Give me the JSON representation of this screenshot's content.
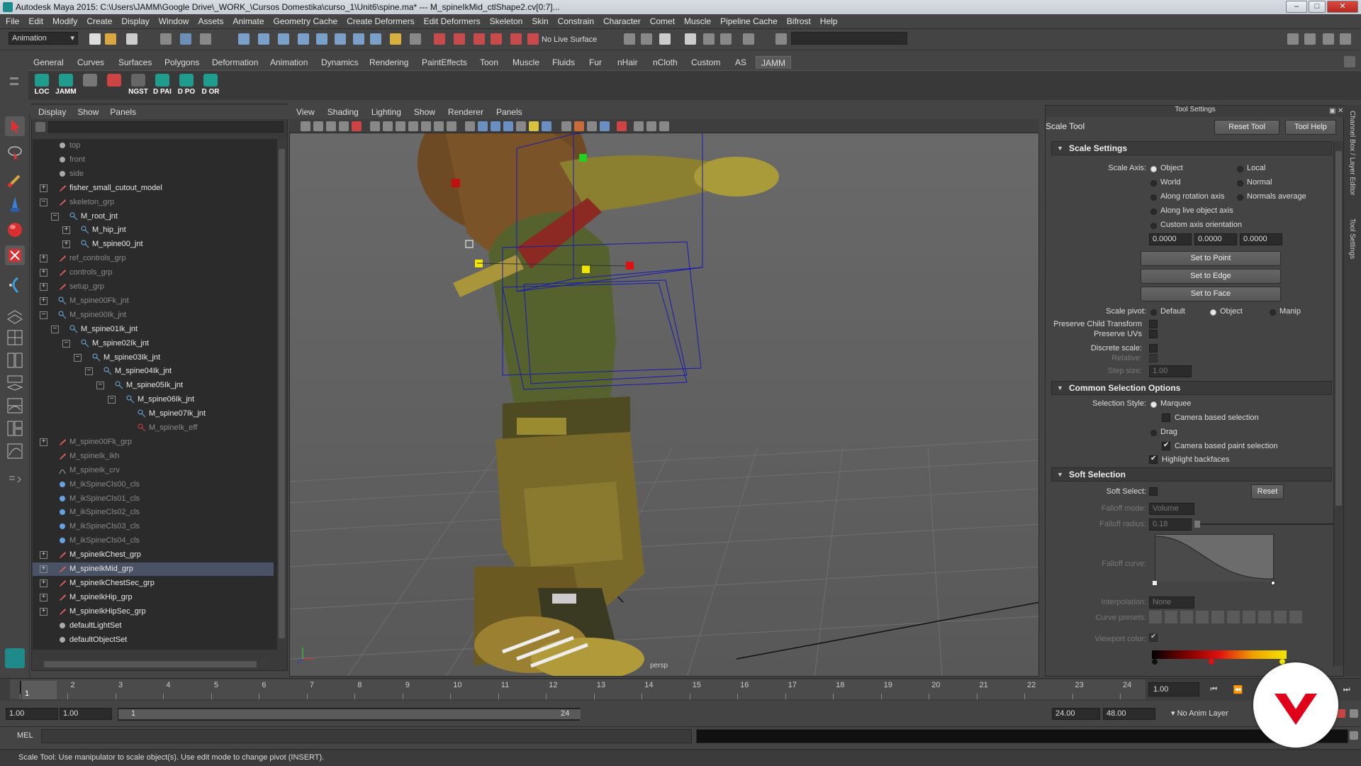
{
  "window": {
    "title": "Autodesk Maya 2015: C:\\Users\\JAMM\\Google Drive\\_WORK_\\Cursos Domestika\\curso_1\\Unit6\\spine.ma*   ---   M_spineIkMid_ctlShape2.cv[0:7]...",
    "minimize": "–",
    "maximize": "□",
    "close": "✕"
  },
  "menubar": [
    "File",
    "Edit",
    "Modify",
    "Create",
    "Display",
    "Window",
    "Assets",
    "Animate",
    "Geometry Cache",
    "Create Deformers",
    "Edit Deformers",
    "Skeleton",
    "Skin",
    "Constrain",
    "Character",
    "Comet",
    "Muscle",
    "Pipeline Cache",
    "Bifrost",
    "Help"
  ],
  "toolbar": {
    "mode": "Animation",
    "live_surface": "No Live Surface"
  },
  "shelf_tabs": [
    "General",
    "Curves",
    "Surfaces",
    "Polygons",
    "Deformation",
    "Animation",
    "Dynamics",
    "Rendering",
    "PaintEffects",
    "Toon",
    "Muscle",
    "Fluids",
    "Fur",
    "nHair",
    "nCloth",
    "Custom",
    "AS",
    "JAMM"
  ],
  "shelf_active": "JAMM",
  "shelf_buttons": [
    "LOC",
    "JAMM",
    "",
    "",
    "NGST",
    "D PAI",
    "D PO",
    "D OR"
  ],
  "outliner": {
    "menu": [
      "Display",
      "Show",
      "Panels"
    ],
    "rows": [
      {
        "label": "top",
        "exp": "",
        "icon": "camera",
        "dim": true,
        "indent": 0
      },
      {
        "label": "front",
        "exp": "",
        "icon": "camera",
        "dim": true,
        "indent": 0
      },
      {
        "label": "side",
        "exp": "",
        "icon": "camera",
        "dim": true,
        "indent": 0
      },
      {
        "label": "fisher_small_cutout_model",
        "exp": "+",
        "icon": "group",
        "dim": false,
        "indent": 0
      },
      {
        "label": "skeleton_grp",
        "exp": "−",
        "icon": "group",
        "dim": true,
        "indent": 0
      },
      {
        "label": "M_root_jnt",
        "exp": "−",
        "icon": "joint",
        "dim": false,
        "indent": 1
      },
      {
        "label": "M_hip_jnt",
        "exp": "+",
        "icon": "joint",
        "dim": false,
        "indent": 2
      },
      {
        "label": "M_spine00_jnt",
        "exp": "+",
        "icon": "joint",
        "dim": false,
        "indent": 2
      },
      {
        "label": "ref_controls_grp",
        "exp": "+",
        "icon": "group",
        "dim": true,
        "indent": 0
      },
      {
        "label": "controls_grp",
        "exp": "+",
        "icon": "group",
        "dim": true,
        "indent": 0
      },
      {
        "label": "setup_grp",
        "exp": "+",
        "icon": "group",
        "dim": true,
        "indent": 0
      },
      {
        "label": "M_spine00Fk_jnt",
        "exp": "+",
        "icon": "joint",
        "dim": true,
        "indent": 0
      },
      {
        "label": "M_spine00Ik_jnt",
        "exp": "−",
        "icon": "joint",
        "dim": true,
        "indent": 0
      },
      {
        "label": "M_spine01Ik_jnt",
        "exp": "−",
        "icon": "joint",
        "dim": false,
        "indent": 1
      },
      {
        "label": "M_spine02Ik_jnt",
        "exp": "−",
        "icon": "joint",
        "dim": false,
        "indent": 2
      },
      {
        "label": "M_spine03Ik_jnt",
        "exp": "−",
        "icon": "joint",
        "dim": false,
        "indent": 3
      },
      {
        "label": "M_spine04Ik_jnt",
        "exp": "−",
        "icon": "joint",
        "dim": false,
        "indent": 4
      },
      {
        "label": "M_spine05Ik_jnt",
        "exp": "−",
        "icon": "joint",
        "dim": false,
        "indent": 5
      },
      {
        "label": "M_spine06Ik_jnt",
        "exp": "−",
        "icon": "joint",
        "dim": false,
        "indent": 6
      },
      {
        "label": "M_spine07Ik_jnt",
        "exp": "",
        "icon": "joint",
        "dim": false,
        "indent": 7
      },
      {
        "label": "M_spineIk_eff",
        "exp": "",
        "icon": "effector",
        "dim": true,
        "indent": 7
      },
      {
        "label": "M_spine00Fk_grp",
        "exp": "+",
        "icon": "group",
        "dim": true,
        "indent": 0
      },
      {
        "label": "M_spineIk_ikh",
        "exp": "",
        "icon": "group",
        "dim": true,
        "indent": 0
      },
      {
        "label": "M_spineIk_crv",
        "exp": "",
        "icon": "curve",
        "dim": true,
        "indent": 0
      },
      {
        "label": "M_ikSpineCls00_cls",
        "exp": "",
        "icon": "cluster",
        "dim": true,
        "indent": 0
      },
      {
        "label": "M_ikSpineCls01_cls",
        "exp": "",
        "icon": "cluster",
        "dim": true,
        "indent": 0
      },
      {
        "label": "M_ikSpineCls02_cls",
        "exp": "",
        "icon": "cluster",
        "dim": true,
        "indent": 0
      },
      {
        "label": "M_ikSpineCls03_cls",
        "exp": "",
        "icon": "cluster",
        "dim": true,
        "indent": 0
      },
      {
        "label": "M_ikSpineCls04_cls",
        "exp": "",
        "icon": "cluster",
        "dim": true,
        "indent": 0
      },
      {
        "label": "M_spineIkChest_grp",
        "exp": "+",
        "icon": "group",
        "dim": false,
        "indent": 0
      },
      {
        "label": "M_spineIkMid_grp",
        "exp": "+",
        "icon": "group",
        "dim": false,
        "indent": 0,
        "selected": true
      },
      {
        "label": "M_spineIkChestSec_grp",
        "exp": "+",
        "icon": "group",
        "dim": false,
        "indent": 0
      },
      {
        "label": "M_spineIkHip_grp",
        "exp": "+",
        "icon": "group",
        "dim": false,
        "indent": 0
      },
      {
        "label": "M_spineIkHipSec_grp",
        "exp": "+",
        "icon": "group",
        "dim": false,
        "indent": 0
      },
      {
        "label": "defaultLightSet",
        "exp": "",
        "icon": "set",
        "dim": false,
        "indent": 0
      },
      {
        "label": "defaultObjectSet",
        "exp": "",
        "icon": "set",
        "dim": false,
        "indent": 0
      }
    ]
  },
  "viewport": {
    "menu": [
      "View",
      "Shading",
      "Lighting",
      "Show",
      "Renderer",
      "Panels"
    ],
    "camera_label": "persp"
  },
  "tool_settings": {
    "panel_title": "Tool Settings",
    "tool_name": "Scale Tool",
    "reset_tool": "Reset Tool",
    "tool_help": "Tool Help",
    "scale_settings": {
      "header": "Scale Settings",
      "scale_axis_label": "Scale Axis:",
      "axis_options": [
        "Object",
        "Local",
        "World",
        "Normal",
        "Along rotation axis",
        "Normals average",
        "Along live object axis",
        "Custom axis orientation"
      ],
      "axis_selected": "Object",
      "custom_values": [
        "0.0000",
        "0.0000",
        "0.0000"
      ],
      "set_to_point": "Set to Point",
      "set_to_edge": "Set to Edge",
      "set_to_face": "Set to Face",
      "scale_pivot_label": "Scale pivot:",
      "pivot_options": [
        "Default",
        "Object",
        "Manip"
      ],
      "pivot_selected": "Object",
      "preserve_child": "Preserve Child Transform",
      "preserve_uvs": "Preserve UVs",
      "discrete_scale": "Discrete scale:",
      "relative": "Relative:",
      "step_size": "Step size:",
      "step_value": "1.00"
    },
    "common_selection": {
      "header": "Common Selection Options",
      "selection_style_label": "Selection Style:",
      "marquee": "Marquee",
      "camera_based_selection": "Camera based selection",
      "drag": "Drag",
      "camera_based_paint": "Camera based paint selection",
      "highlight_backfaces": "Highlight backfaces"
    },
    "soft_selection": {
      "header": "Soft Selection",
      "soft_select_label": "Soft Select:",
      "reset": "Reset",
      "falloff_mode_label": "Falloff mode:",
      "falloff_mode_value": "Volume",
      "falloff_radius_label": "Falloff radius:",
      "falloff_radius_value": "0.18",
      "falloff_curve_label": "Falloff curve:",
      "interpolation_label": "Interpolation:",
      "interpolation_value": "None",
      "curve_presets_label": "Curve presets:",
      "viewport_color_label": "Viewport color:"
    }
  },
  "right_strip": [
    "Channel Box / Layer Editor",
    "Tool Settings"
  ],
  "timeline": {
    "ticks": [
      "1",
      "2",
      "3",
      "4",
      "5",
      "6",
      "7",
      "8",
      "9",
      "10",
      "11",
      "12",
      "13",
      "14",
      "15",
      "16",
      "17",
      "18",
      "19",
      "20",
      "21",
      "22",
      "23",
      "24"
    ],
    "current_frame_marker": "1",
    "current_time": "1.00"
  },
  "range": {
    "start_time": "1.00",
    "start_range": "1.00",
    "slider_start": "1",
    "slider_end": "24",
    "end_range": "24.00",
    "end_time": "48.00",
    "anim_layer": "No Anim Layer"
  },
  "command_line": {
    "language": "MEL"
  },
  "status": "Scale Tool: Use manipulator to scale object(s). Use edit mode to change pivot (INSERT).",
  "colors": {
    "accent_selected": "#4a5266",
    "manip_yellow": "#f2e600",
    "manip_red": "#e01010",
    "manip_green": "#22d022",
    "domestika_red": "#e0001a"
  }
}
